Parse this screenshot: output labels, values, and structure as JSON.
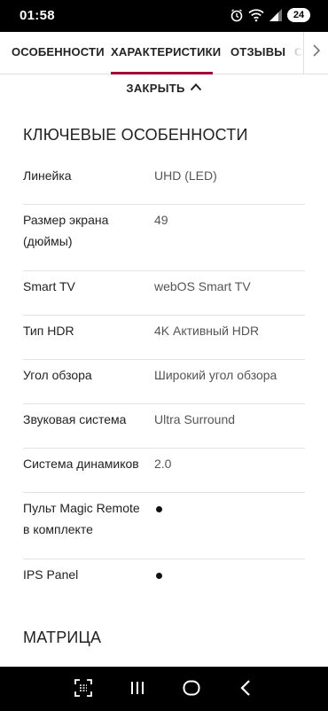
{
  "status_bar": {
    "time": "01:58",
    "battery": "24",
    "icons": [
      "alarm-icon",
      "wifi-icon",
      "signal-icon",
      "battery-icon"
    ]
  },
  "tabs": {
    "items": [
      {
        "label": "ОСОБЕННОСТИ"
      },
      {
        "label": "ХАРАКТЕРИСТИКИ"
      },
      {
        "label": "ОТЗЫВЫ"
      },
      {
        "label": "С"
      }
    ],
    "active_index": 1,
    "scroll_icon": "chevron-right-icon"
  },
  "close_toggle": {
    "label": "ЗАКРЫТЬ",
    "icon": "chevron-up-icon"
  },
  "sections": [
    {
      "title": "КЛЮЧЕВЫЕ ОСОБЕННОСТИ",
      "rows": [
        {
          "label": "Линейка",
          "value": "UHD (LED)"
        },
        {
          "label": "Размер экрана (дюймы)",
          "value": "49"
        },
        {
          "label": "Smart TV",
          "value": "webOS Smart TV"
        },
        {
          "label": "Тип HDR",
          "value": "4K Активный HDR"
        },
        {
          "label": "Угол обзора",
          "value": "Широкий угол обзора"
        },
        {
          "label": "Звуковая система",
          "value": "Ultra Surround"
        },
        {
          "label": "Система динамиков",
          "value": "2.0"
        },
        {
          "label": "Пульт Magic Remote в комплекте",
          "value": "•"
        },
        {
          "label": "IPS Panel",
          "value": "•"
        }
      ]
    },
    {
      "title": "МАТРИЦА"
    }
  ],
  "nav_bar": {
    "buttons": [
      "screenshot-scan-icon",
      "recents-icon",
      "home-icon",
      "back-icon"
    ]
  },
  "colors": {
    "accent": "#a50034",
    "text": "#222222",
    "value_text": "#555555",
    "divider": "#e2e2e2"
  }
}
